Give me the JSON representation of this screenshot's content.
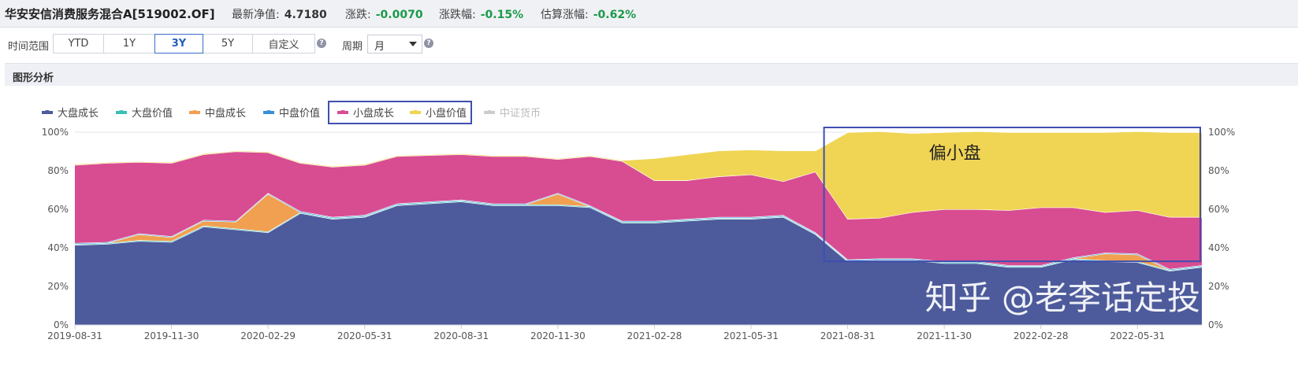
{
  "header": {
    "fund_title": "华安安信消费服务混合A[519002.OF]",
    "nav_label": "最新净值:",
    "nav_value": "4.7180",
    "change_label": "涨跌:",
    "change_value": "-0.0070",
    "change_pct_label": "涨跌幅:",
    "change_pct_value": "-0.15%",
    "est_label": "估算涨幅:",
    "est_value": "-0.62%",
    "negative_color": "#1a9a4a"
  },
  "controls": {
    "range_label": "时间范围",
    "range_buttons": [
      "YTD",
      "1Y",
      "3Y",
      "5Y",
      "自定义"
    ],
    "range_selected": "3Y",
    "period_label": "周期",
    "period_value": "月",
    "help_icon": "question-circle-icon"
  },
  "panel": {
    "title": "图形分析"
  },
  "chart_data": {
    "type": "area",
    "stacked": true,
    "x_tick_labels": [
      "2019-08-31",
      "2019-11-30",
      "2020-02-29",
      "2020-05-31",
      "2020-08-31",
      "2020-11-30",
      "2021-02-28",
      "2021-05-31",
      "2021-08-31",
      "2021-11-30",
      "2022-02-28",
      "2022-05-31"
    ],
    "x": [
      "2019-08-31",
      "2019-09-30",
      "2019-10-31",
      "2019-11-30",
      "2019-12-31",
      "2020-01-31",
      "2020-02-29",
      "2020-03-31",
      "2020-04-30",
      "2020-05-31",
      "2020-06-30",
      "2020-07-31",
      "2020-08-31",
      "2020-09-30",
      "2020-10-31",
      "2020-11-30",
      "2020-12-31",
      "2021-01-31",
      "2021-02-28",
      "2021-03-31",
      "2021-04-30",
      "2021-05-31",
      "2021-06-30",
      "2021-07-31",
      "2021-08-31",
      "2021-09-30",
      "2021-10-31",
      "2021-11-30",
      "2021-12-31",
      "2022-01-31",
      "2022-02-28",
      "2022-03-31",
      "2022-04-30",
      "2022-05-31",
      "2022-06-30",
      "2022-07-31"
    ],
    "ylim": [
      0,
      100
    ],
    "y_tick_labels": [
      "0%",
      "20%",
      "40%",
      "60%",
      "80%",
      "100%"
    ],
    "legend_position": "top-left",
    "series": [
      {
        "name": "大盘成长",
        "color": "#4d5b9c",
        "values": [
          41.5,
          42,
          43.5,
          43,
          51,
          49.5,
          48,
          58,
          55,
          56,
          62,
          63,
          64,
          62,
          62,
          62,
          61,
          53,
          53,
          54,
          55,
          55,
          56,
          47,
          33,
          33.5,
          33.5,
          32,
          32,
          30,
          30,
          34,
          33,
          32.5,
          28,
          30
        ]
      },
      {
        "name": "大盘价值",
        "color": "#3cc0b4",
        "values": [
          0.5,
          0.5,
          0.5,
          0.5,
          0.5,
          0.5,
          0.5,
          0.5,
          0.5,
          0.5,
          0.5,
          0.5,
          0.5,
          0.5,
          0.5,
          0.5,
          0.5,
          0.5,
          0.5,
          0.5,
          0.5,
          0.5,
          0.5,
          0.5,
          0.5,
          0.5,
          0.5,
          0.5,
          0.5,
          0.5,
          0.5,
          0.5,
          0.5,
          0.5,
          0.5,
          0.5
        ]
      },
      {
        "name": "中盘成长",
        "color": "#f0a050",
        "values": [
          0,
          0,
          3,
          2,
          2.5,
          3.5,
          19.5,
          0,
          0,
          0,
          0,
          0,
          0,
          0,
          0,
          5.5,
          0,
          0,
          0,
          0,
          0,
          0,
          0,
          0,
          0,
          0,
          0,
          0,
          0,
          0,
          0,
          0,
          3.5,
          3.5,
          0,
          0
        ]
      },
      {
        "name": "中盘价值",
        "color": "#3a8fd8",
        "values": [
          0.5,
          0.5,
          0.5,
          0.5,
          0.5,
          0.5,
          0.5,
          0.5,
          0.5,
          0.5,
          0.5,
          0.5,
          0.5,
          0.5,
          0.5,
          0.5,
          0.5,
          0.5,
          0.5,
          0.5,
          0.5,
          0.5,
          0.5,
          0.5,
          0.5,
          0.5,
          0.5,
          0.5,
          0.5,
          0.5,
          0.5,
          0.5,
          0.5,
          0.5,
          0.5,
          0.5
        ]
      },
      {
        "name": "小盘成长",
        "color": "#d84c91",
        "values": [
          40.5,
          41,
          37,
          38,
          34,
          36,
          21,
          25,
          26,
          26,
          24.5,
          24,
          23.5,
          24.5,
          24.5,
          17.5,
          25.5,
          31,
          21,
          20,
          21,
          22,
          17.5,
          31.5,
          21,
          21,
          24,
          27,
          27,
          28.5,
          30,
          26,
          21,
          22.5,
          27,
          25
        ]
      },
      {
        "name": "小盘价值",
        "color": "#f0d554",
        "values": [
          0.5,
          0.5,
          0.5,
          0.5,
          0.5,
          0.5,
          0.5,
          0.5,
          0.5,
          0.5,
          0.5,
          0.5,
          0.5,
          0.5,
          0.5,
          0.5,
          0.5,
          0.5,
          11.5,
          13.5,
          13.5,
          13,
          16,
          11,
          45,
          45,
          41,
          40,
          40.5,
          40.5,
          39,
          39,
          41.5,
          41,
          44,
          44
        ]
      },
      {
        "name": "中证货币",
        "color": "#cccccc",
        "values": [
          0,
          0,
          0,
          0,
          0,
          0,
          0,
          0,
          0,
          0,
          0,
          0,
          0,
          0,
          0,
          0,
          0,
          0,
          0,
          0,
          0,
          0,
          0,
          0,
          0,
          0,
          0,
          0,
          0,
          0,
          0,
          0,
          0,
          0,
          0,
          0
        ]
      }
    ],
    "inactive_series": [
      "中证货币"
    ],
    "highlight_legend": [
      "小盘成长",
      "小盘价值"
    ],
    "annotation": {
      "text": "偏小盘",
      "x_range": [
        "2021-08-31",
        "2022-07-31"
      ],
      "y_range": [
        33,
        100
      ]
    },
    "watermark": "知乎 @老李话定投",
    "box_color": "#3d4fb0"
  }
}
